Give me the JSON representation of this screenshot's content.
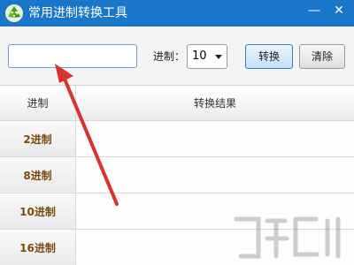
{
  "window": {
    "title": "常用进制转换工具",
    "minimize_glyph": "—",
    "close_glyph": "✕",
    "titlebar_color": "#1a76c8"
  },
  "toolbar": {
    "number_input": {
      "value": "",
      "placeholder": ""
    },
    "base_label": "进制：",
    "base_selected": "10",
    "convert_label": "转换",
    "clear_label": "清除"
  },
  "table": {
    "headers": {
      "base": "进制",
      "result": "转换结果"
    },
    "rows": [
      {
        "base": "2进制",
        "result": ""
      },
      {
        "base": "8进制",
        "result": ""
      },
      {
        "base": "10进制",
        "result": ""
      },
      {
        "base": "16进制",
        "result": ""
      }
    ]
  },
  "annotation": {
    "arrow_color": "#d9342b"
  },
  "icons": {
    "app": "recycle-leaf-icon",
    "dropdown": "caret-down-icon",
    "watermark": "download-watermark-logo"
  }
}
